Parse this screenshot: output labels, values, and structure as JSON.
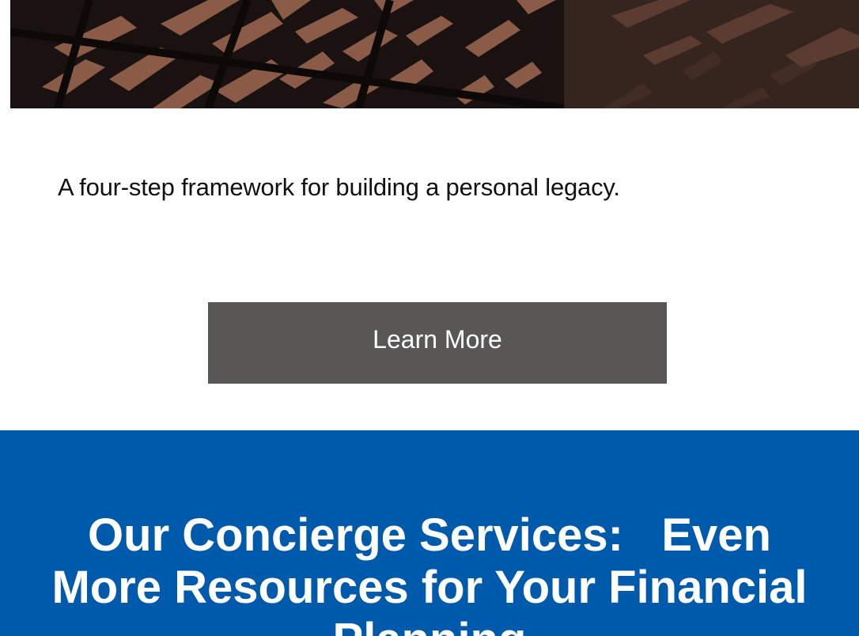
{
  "hero": {
    "image_alt": "architectural-shadow-photo"
  },
  "content": {
    "tagline": "A four-step framework for building a personal legacy.",
    "learn_more_label": "Learn More"
  },
  "concierge": {
    "title": "Our Concierge Services:   Even More Resources for Your Financial Planning"
  },
  "colors": {
    "button_bg": "#585756",
    "section_blue": "#005aab",
    "hero_dark": "#1a1210",
    "hero_light": "#8a5c48"
  }
}
